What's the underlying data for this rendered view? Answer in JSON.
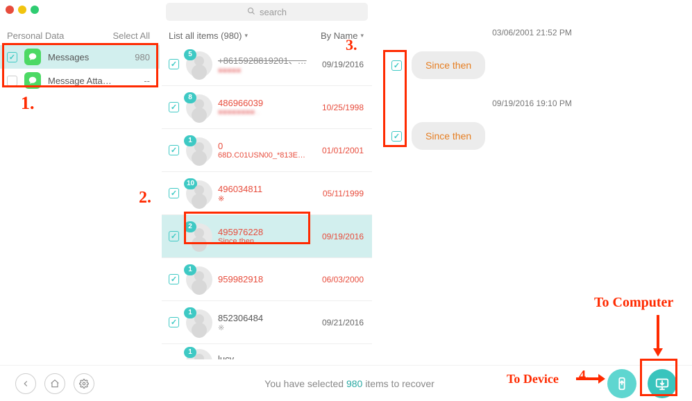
{
  "sidebar": {
    "header": "Personal Data",
    "select_all": "Select All",
    "items": [
      {
        "label": "Messages",
        "count": "980"
      },
      {
        "label": "Message Atta…",
        "count": "--"
      }
    ]
  },
  "search": {
    "placeholder": "search"
  },
  "mid_header": {
    "filter": "List all items (980)",
    "sort": "By Name"
  },
  "contacts": [
    {
      "badge": "5",
      "name": "+8615928819201、…",
      "sub": "",
      "date": "09/19/2016"
    },
    {
      "badge": "8",
      "name": "486966039",
      "sub": "",
      "date": "10/25/1998"
    },
    {
      "badge": "1",
      "name": "0",
      "sub": "68D.C01USN00_*813E…",
      "date": "01/01/2001"
    },
    {
      "badge": "10",
      "name": "496034811",
      "sub": "※",
      "date": "05/11/1999"
    },
    {
      "badge": "2",
      "name": "495976228",
      "sub": "Since then",
      "date": "09/19/2016"
    },
    {
      "badge": "1",
      "name": "959982918",
      "sub": "",
      "date": "06/03/2000"
    },
    {
      "badge": "1",
      "name": "852306484",
      "sub": "※",
      "date": "09/21/2016"
    },
    {
      "badge": "1",
      "name": "lucy",
      "sub": "",
      "date": ""
    }
  ],
  "messages": {
    "ts1": "03/06/2001 21:52 PM",
    "bubble1": "Since then",
    "ts2": "09/19/2016 19:10 PM",
    "bubble2": "Since then"
  },
  "footer": {
    "prefix": "You have selected ",
    "count": "980",
    "suffix": " items to recover"
  },
  "annotations": {
    "n1": "1.",
    "n2": "2.",
    "n3": "3.",
    "n4": "4.",
    "to_device": "To Device",
    "to_computer": "To Computer"
  }
}
